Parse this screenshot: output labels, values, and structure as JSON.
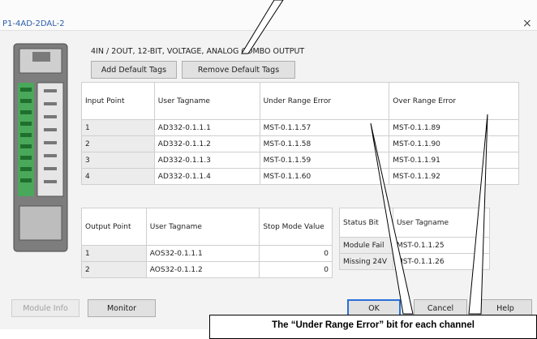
{
  "window": {
    "title": "P1-4AD-2DAL-2",
    "close_glyph": "×"
  },
  "description": "4IN / 2OUT, 12-BIT, VOLTAGE, ANALOG COMBO OUTPUT",
  "buttons": {
    "add_default_tags": "Add Default Tags",
    "remove_default_tags": "Remove Default Tags",
    "module_info": "Module Info",
    "monitor": "Monitor",
    "ok": "OK",
    "cancel": "Cancel",
    "help": "Help"
  },
  "input_table": {
    "headers": [
      "Input Point",
      "User Tagname",
      "Under Range Error",
      "Over Range Error"
    ],
    "rows": [
      [
        "1",
        "AD332-0.1.1.1",
        "MST-0.1.1.57",
        "MST-0.1.1.89"
      ],
      [
        "2",
        "AD332-0.1.1.2",
        "MST-0.1.1.58",
        "MST-0.1.1.90"
      ],
      [
        "3",
        "AD332-0.1.1.3",
        "MST-0.1.1.59",
        "MST-0.1.1.91"
      ],
      [
        "4",
        "AD332-0.1.1.4",
        "MST-0.1.1.60",
        "MST-0.1.1.92"
      ]
    ]
  },
  "output_table": {
    "headers": [
      "Output Point",
      "User Tagname",
      "Stop Mode Value"
    ],
    "rows": [
      [
        "1",
        "AOS32-0.1.1.1",
        "0"
      ],
      [
        "2",
        "AOS32-0.1.1.2",
        "0"
      ]
    ]
  },
  "status_table": {
    "headers": [
      "Status Bit",
      "User Tagname"
    ],
    "rows": [
      [
        "Module Fail",
        "MST-0.1.1.25"
      ],
      [
        "Missing 24V",
        "MST-0.1.1.26"
      ]
    ]
  },
  "callout": {
    "text": "The “Under Range Error” bit for each channel"
  },
  "colors": {
    "title_text": "#2a5dab",
    "dialog_bg": "#f3f3f3",
    "grid_line": "#cfcfcf",
    "row_header_bg": "#ececec",
    "default_button_border": "#2a6fd6"
  }
}
